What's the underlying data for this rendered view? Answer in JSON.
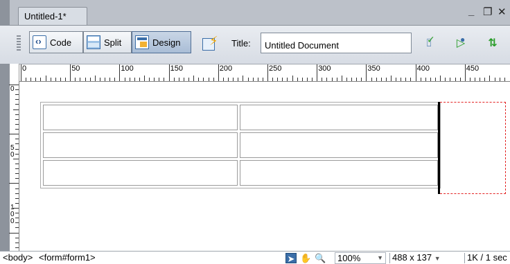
{
  "document_tab": {
    "label": "Untitled-1*"
  },
  "window_controls": {
    "minimize": "_",
    "restore": "❐",
    "close": "✕"
  },
  "toolbar": {
    "view_buttons": [
      {
        "label": "Code",
        "icon": "code-view-icon",
        "active": false
      },
      {
        "label": "Split",
        "icon": "split-view-icon",
        "active": false
      },
      {
        "label": "Design",
        "icon": "design-view-icon",
        "active": true
      }
    ],
    "refresh_icon": "refresh-design-view-icon",
    "title_label": "Title:",
    "title_value": "Untitled Document",
    "right_icons": [
      "validate-markup-icon",
      "preview-in-browser-icon",
      "file-transfer-icon"
    ]
  },
  "ruler": {
    "horizontal_labels": [
      "0",
      "50",
      "100",
      "150",
      "200",
      "250",
      "300",
      "350",
      "400",
      "450"
    ],
    "vertical_labels": [
      "0",
      "50",
      "100"
    ]
  },
  "canvas": {
    "table": {
      "rows": 3,
      "columns": 2
    },
    "form_outline_color": "#e32222"
  },
  "statusbar": {
    "tag_selector": [
      "<body>",
      "<form#form1>"
    ],
    "tools": [
      "pointer-tool-icon",
      "hand-tool-icon",
      "zoom-tool-icon"
    ],
    "zoom": "100%",
    "window_size": "488 x 137",
    "download_stats": "1K / 1 sec"
  },
  "colors": {
    "accent": "#3b6ea8",
    "tabbar": "#bcc1c9",
    "active_button": "#a9bdd6"
  }
}
